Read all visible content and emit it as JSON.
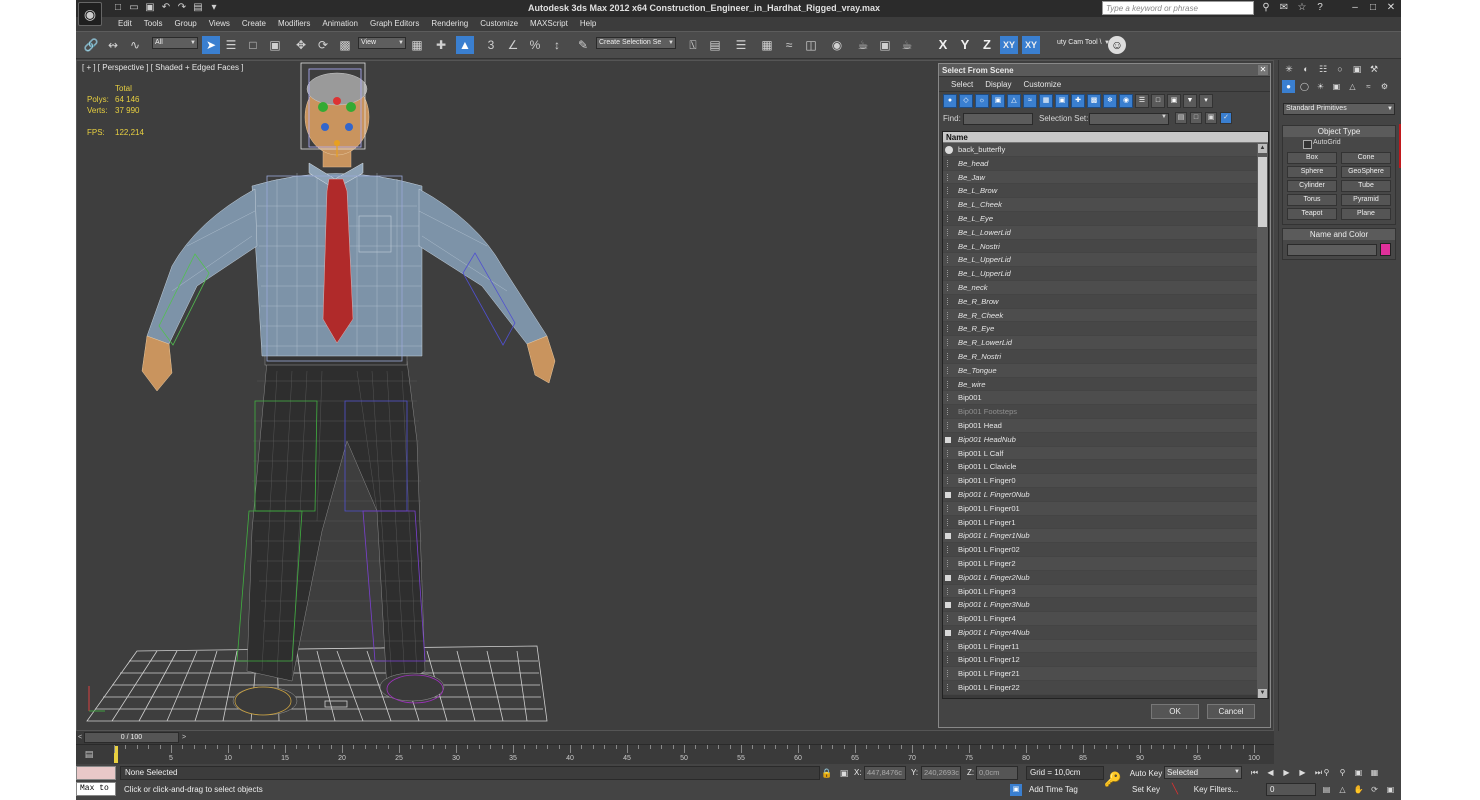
{
  "window": {
    "title": "Autodesk 3ds Max  2012 x64     Construction_Engineer_in_Hardhat_Rigged_vray.max",
    "search_placeholder": "Type a keyword or phrase"
  },
  "menu": [
    "Edit",
    "Tools",
    "Group",
    "Views",
    "Create",
    "Modifiers",
    "Animation",
    "Graph Editors",
    "Rendering",
    "Customize",
    "MAXScript",
    "Help"
  ],
  "toolbar": {
    "selection_filter": "All",
    "reference_coord": "View",
    "named_selection": "Create Selection Se",
    "cam_tool": "uty Cam Tool \\"
  },
  "viewport": {
    "label": "[ + ] [ Perspective ] [ Shaded + Edged Faces ]",
    "stats_header": "Total",
    "polys_label": "Polys:",
    "polys_value": "64 146",
    "verts_label": "Verts:",
    "verts_value": "37 990",
    "fps_label": "FPS:",
    "fps_value": "122,214"
  },
  "dialog": {
    "title": "Select From Scene",
    "menu": [
      "Select",
      "Display",
      "Customize"
    ],
    "find_label": "Find:",
    "selection_set_label": "Selection Set:",
    "column_name": "Name",
    "rows": [
      {
        "name": "back_butterfly",
        "style": "circ"
      },
      {
        "name": "Be_head",
        "style": "it"
      },
      {
        "name": "Be_Jaw",
        "style": "it"
      },
      {
        "name": "Be_L_Brow",
        "style": "it"
      },
      {
        "name": "Be_L_Cheek",
        "style": "it"
      },
      {
        "name": "Be_L_Eye",
        "style": "it"
      },
      {
        "name": "Be_L_LowerLid",
        "style": "it"
      },
      {
        "name": "Be_L_Nostri",
        "style": "it"
      },
      {
        "name": "Be_L_UpperLid",
        "style": "it"
      },
      {
        "name": "Be_L_UpperLid",
        "style": "it"
      },
      {
        "name": "Be_neck",
        "style": "it"
      },
      {
        "name": "Be_R_Brow",
        "style": "it"
      },
      {
        "name": "Be_R_Cheek",
        "style": "it"
      },
      {
        "name": "Be_R_Eye",
        "style": "it"
      },
      {
        "name": "Be_R_LowerLid",
        "style": "it"
      },
      {
        "name": "Be_R_Nostri",
        "style": "it"
      },
      {
        "name": "Be_Tongue",
        "style": "it"
      },
      {
        "name": "Be_wire",
        "style": "it"
      },
      {
        "name": "Bip001",
        "style": ""
      },
      {
        "name": "Bip001 Footsteps",
        "style": "dim"
      },
      {
        "name": "Bip001 Head",
        "style": ""
      },
      {
        "name": "Bip001 HeadNub",
        "style": "it doc"
      },
      {
        "name": "Bip001 L Calf",
        "style": ""
      },
      {
        "name": "Bip001 L Clavicle",
        "style": ""
      },
      {
        "name": "Bip001 L Finger0",
        "style": ""
      },
      {
        "name": "Bip001 L Finger0Nub",
        "style": "it doc"
      },
      {
        "name": "Bip001 L Finger01",
        "style": ""
      },
      {
        "name": "Bip001 L Finger1",
        "style": ""
      },
      {
        "name": "Bip001 L Finger1Nub",
        "style": "it doc"
      },
      {
        "name": "Bip001 L Finger02",
        "style": ""
      },
      {
        "name": "Bip001 L Finger2",
        "style": ""
      },
      {
        "name": "Bip001 L Finger2Nub",
        "style": "it doc"
      },
      {
        "name": "Bip001 L Finger3",
        "style": ""
      },
      {
        "name": "Bip001 L Finger3Nub",
        "style": "it doc"
      },
      {
        "name": "Bip001 L Finger4",
        "style": ""
      },
      {
        "name": "Bip001 L Finger4Nub",
        "style": "it doc"
      },
      {
        "name": "Bip001 L Finger11",
        "style": ""
      },
      {
        "name": "Bip001 L Finger12",
        "style": ""
      },
      {
        "name": "Bip001 L Finger21",
        "style": ""
      },
      {
        "name": "Bip001 L Finger22",
        "style": ""
      }
    ],
    "ok_label": "OK",
    "cancel_label": "Cancel"
  },
  "command_panel": {
    "category": "Standard Primitives",
    "object_type_title": "Object Type",
    "autogrid_label": "AutoGrid",
    "primitives": [
      "Box",
      "Cone",
      "Sphere",
      "GeoSphere",
      "Cylinder",
      "Tube",
      "Torus",
      "Pyramid",
      "Teapot",
      "Plane"
    ],
    "name_color_title": "Name and Color",
    "object_color": "#e0309b"
  },
  "timeline": {
    "frame_range": "0 / 100",
    "ticks": [
      "5",
      "10",
      "15",
      "20",
      "25",
      "30",
      "35",
      "40",
      "45",
      "50",
      "55",
      "60",
      "65",
      "70",
      "75",
      "80",
      "85",
      "90",
      "95",
      "100"
    ]
  },
  "status": {
    "selection_status": "None Selected",
    "prompt": "Click or click-and-drag to select objects",
    "maxscript_text": "Max to",
    "x_label": "X:",
    "x_value": "447,8476c",
    "y_label": "Y:",
    "y_value": "240,2693c",
    "z_label": "Z:",
    "z_value": "0,0cm",
    "grid": "Grid = 10,0cm",
    "add_time_tag": "Add Time Tag",
    "auto_key": "Auto Key",
    "set_key": "Set Key",
    "key_mode": "Selected",
    "key_filters": "Key Filters...",
    "current_frame": "0"
  }
}
